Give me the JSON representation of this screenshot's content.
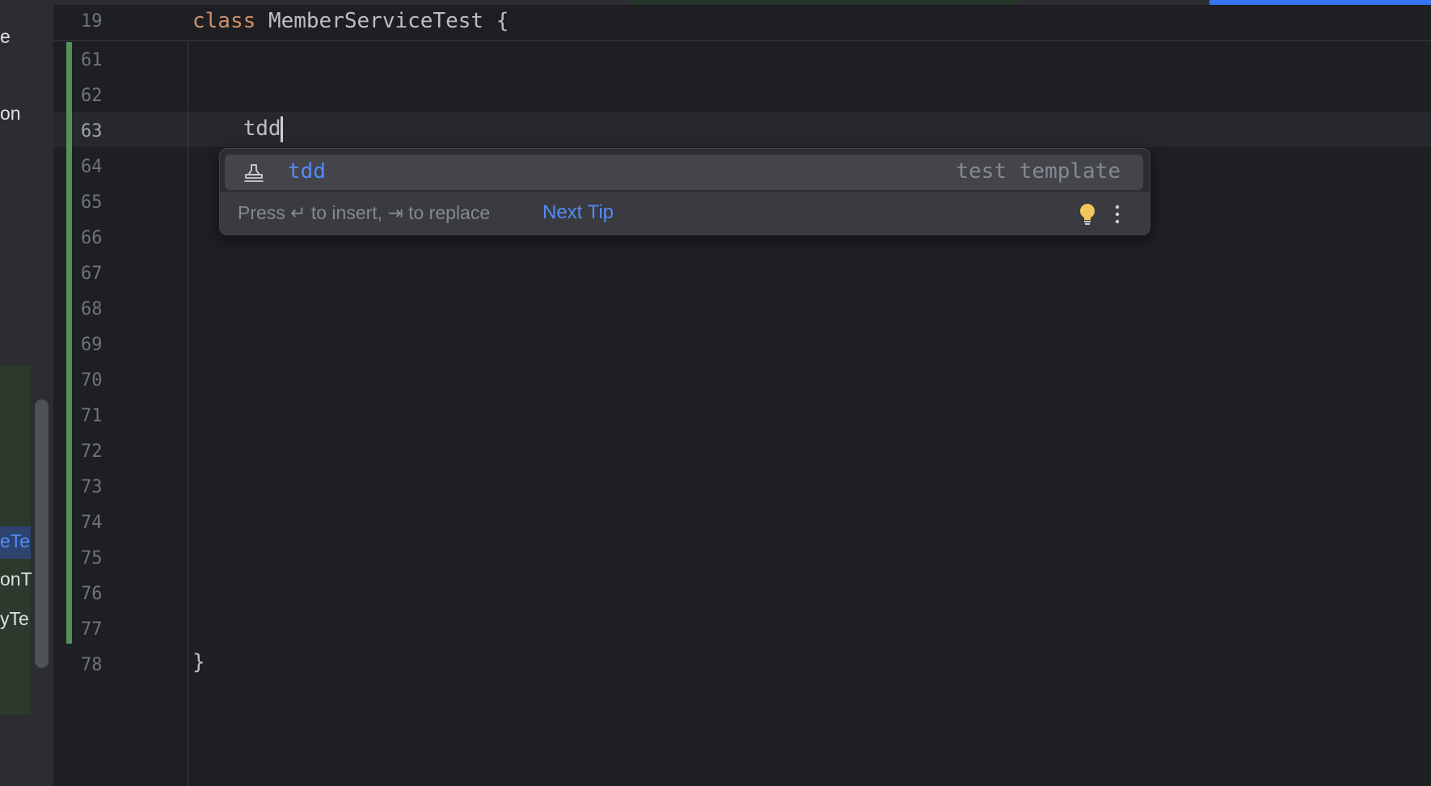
{
  "project_panel": {
    "fragments": [
      "e",
      "on",
      "eTe",
      "onT",
      "yTe"
    ]
  },
  "editor": {
    "sticky": {
      "line": "19",
      "keyword": "class",
      "text": "MemberServiceTest {"
    },
    "lines": [
      {
        "num": "61",
        "text": ""
      },
      {
        "num": "62",
        "text": ""
      },
      {
        "num": "63",
        "text": "    tdd"
      },
      {
        "num": "64",
        "text": ""
      },
      {
        "num": "65",
        "text": ""
      },
      {
        "num": "66",
        "text": ""
      },
      {
        "num": "67",
        "text": ""
      },
      {
        "num": "68",
        "text": ""
      },
      {
        "num": "69",
        "text": ""
      },
      {
        "num": "70",
        "text": ""
      },
      {
        "num": "71",
        "text": ""
      },
      {
        "num": "72",
        "text": ""
      },
      {
        "num": "73",
        "text": ""
      },
      {
        "num": "74",
        "text": ""
      },
      {
        "num": "75",
        "text": ""
      },
      {
        "num": "76",
        "text": ""
      },
      {
        "num": "77",
        "text": ""
      },
      {
        "num": "78",
        "text": "}"
      }
    ],
    "current_line": "63"
  },
  "completion": {
    "item_name": "tdd",
    "item_type": "test template",
    "icon": "stamp-icon",
    "hint": "Press ↵ to insert, ⇥ to replace",
    "next_tip": "Next Tip",
    "bulb_icon": "lightbulb-icon",
    "more_icon": "more-vertical-icon"
  },
  "colors": {
    "keyword": "#cf8e6d",
    "accent": "#548af7",
    "change_marker": "#549159"
  }
}
